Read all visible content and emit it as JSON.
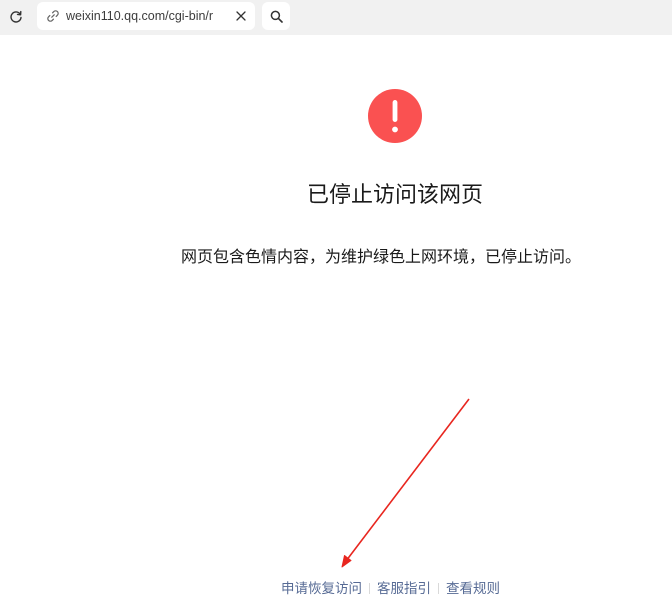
{
  "toolbar": {
    "url": "weixin110.qq.com/cgi-bin/r",
    "icons": {
      "reload": "reload-icon",
      "link": "link-icon",
      "clear": "close-icon",
      "search": "search-icon"
    }
  },
  "page": {
    "title": "已停止访问该网页",
    "description": "网页包含色情内容，为维护绿色上网环境，已停止访问。"
  },
  "footer": {
    "links": [
      "申请恢复访问",
      "客服指引",
      "查看规则"
    ]
  },
  "colors": {
    "warning": "#fa5151",
    "link": "#576b95",
    "annotation_arrow": "#e8261f",
    "toolbar_bg": "#f1f1f1"
  }
}
